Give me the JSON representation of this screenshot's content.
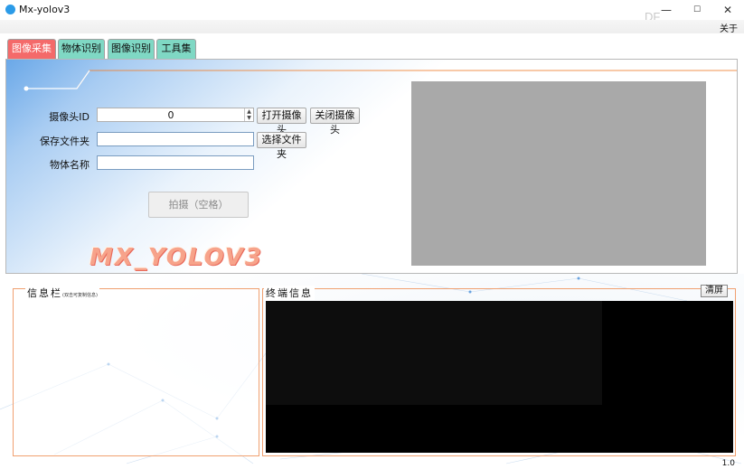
{
  "window": {
    "title": "Mx-yolov3",
    "minimize_glyph": "—",
    "maximize_glyph": "☐",
    "close_glyph": "✕",
    "watermark": "DF"
  },
  "menu": {
    "about": "关于"
  },
  "tabs": [
    {
      "label": "图像采集",
      "active": true
    },
    {
      "label": "物体识别",
      "active": false
    },
    {
      "label": "图像识别",
      "active": false
    },
    {
      "label": "工具集",
      "active": false
    }
  ],
  "capture": {
    "camera_id_label": "摄像头ID",
    "camera_id_value": "0",
    "open_camera_button": "打开摄像头",
    "close_camera_button": "关闭摄像头",
    "save_folder_label": "保存文件夹",
    "save_folder_value": "",
    "choose_folder_button": "选择文件夹",
    "object_name_label": "物体名称",
    "object_name_value": "",
    "shoot_button": "拍摄（空格）",
    "logo_text": "MX_YOLOV3"
  },
  "info_panel": {
    "title": "信息栏",
    "subtitle": "(双击可复制信息)"
  },
  "terminal_panel": {
    "title": "终端信息",
    "clear_button": "清屏"
  },
  "version": "1.0",
  "colors": {
    "active_tab": "#f46a6a",
    "inactive_tab": "#7fd8c4",
    "accent_line": "#f08030",
    "frame": "#f0a070",
    "preview_bg": "#a9a9a9",
    "terminal_bg": "#000000"
  }
}
